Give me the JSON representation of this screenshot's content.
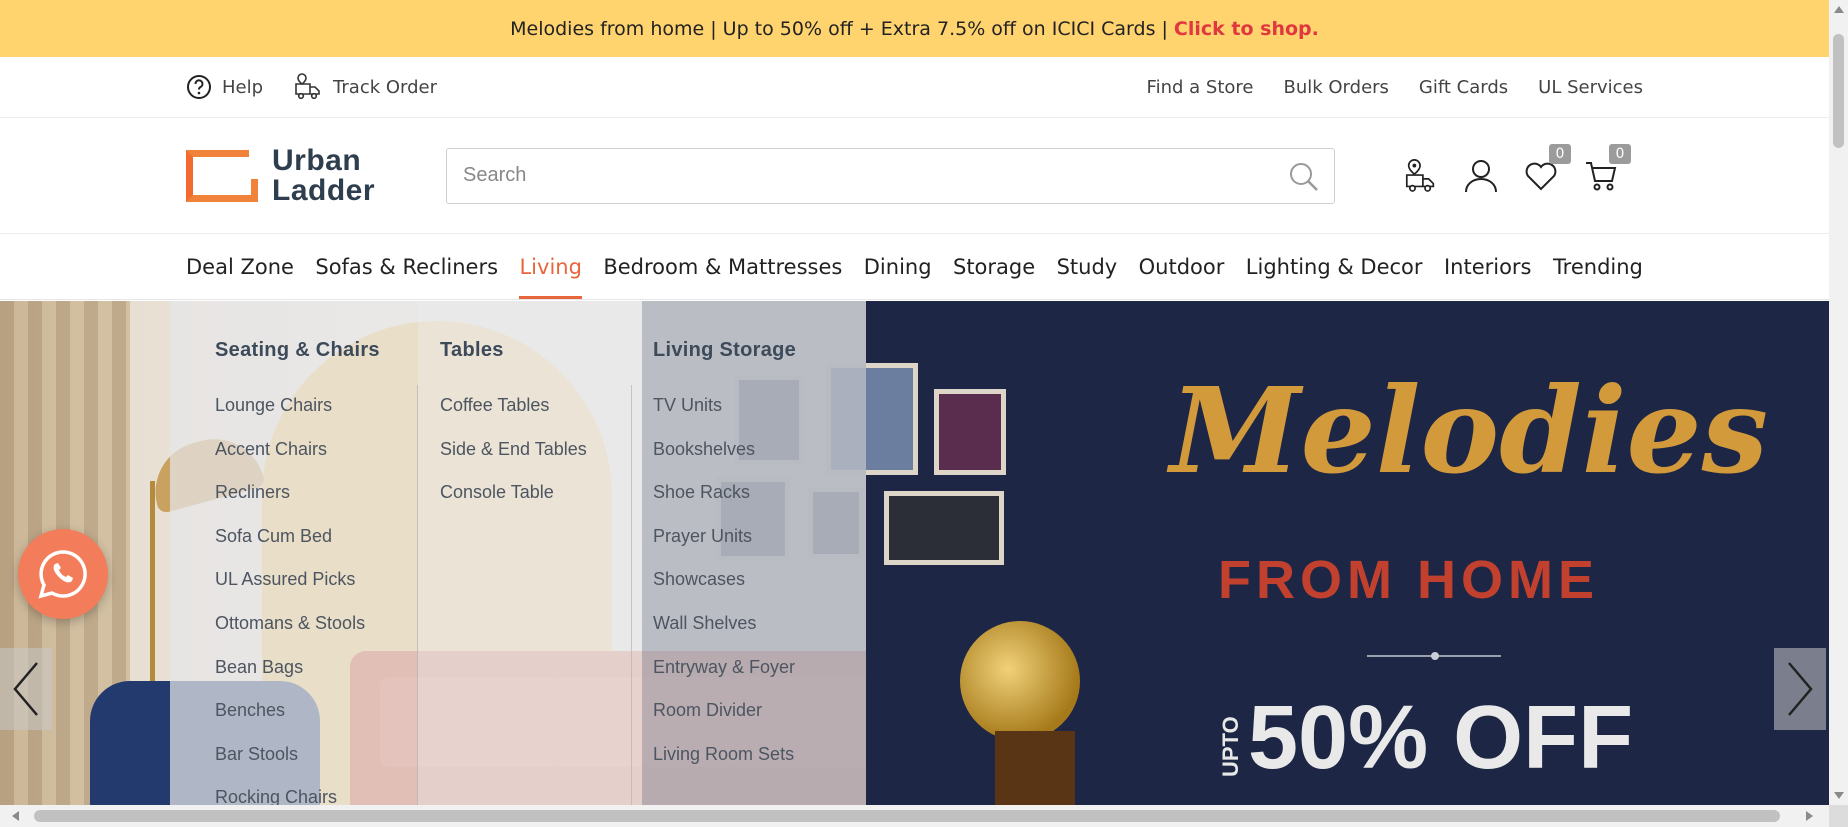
{
  "promo": {
    "text": "Melodies from home | Up to 50% off + Extra 7.5% off on ICICI Cards |",
    "cta": "Click to shop.",
    "bg_color": "#ffd36e",
    "cta_color": "#e0383e"
  },
  "utility": {
    "help": "Help",
    "track_order": "Track Order",
    "links": [
      "Find a Store",
      "Bulk Orders",
      "Gift Cards",
      "UL Services"
    ]
  },
  "header": {
    "logo_line1": "Urban",
    "logo_line2": "Ladder",
    "search_placeholder": "Search",
    "wishlist_count": "0",
    "cart_count": "0",
    "icons": [
      "store-locator-icon",
      "account-icon",
      "wishlist-icon",
      "cart-icon"
    ]
  },
  "nav": {
    "tabs": [
      "Deal Zone",
      "Sofas & Recliners",
      "Living",
      "Bedroom & Mattresses",
      "Dining",
      "Storage",
      "Study",
      "Outdoor",
      "Lighting & Decor",
      "Interiors",
      "Trending"
    ],
    "active": "Living",
    "accent": "#e8663d"
  },
  "mega_menu": {
    "columns": [
      {
        "heading": "Seating & Chairs",
        "items": [
          "Lounge Chairs",
          "Accent Chairs",
          "Recliners",
          "Sofa Cum Bed",
          "UL Assured Picks",
          "Ottomans & Stools",
          "Bean Bags",
          "Benches",
          "Bar Stools",
          "Rocking Chairs"
        ]
      },
      {
        "heading": "Tables",
        "items": [
          "Coffee Tables",
          "Side & End Tables",
          "Console Table"
        ]
      },
      {
        "heading": "Living Storage",
        "items": [
          "TV Units",
          "Bookshelves",
          "Shoe Racks",
          "Prayer Units",
          "Showcases",
          "Wall Shelves",
          "Entryway & Foyer",
          "Room Divider",
          "Living Room Sets"
        ]
      }
    ]
  },
  "hero": {
    "title": "Melodies",
    "subtitle": "FROM HOME",
    "upto": "UPTO",
    "offer": "50% OFF"
  }
}
